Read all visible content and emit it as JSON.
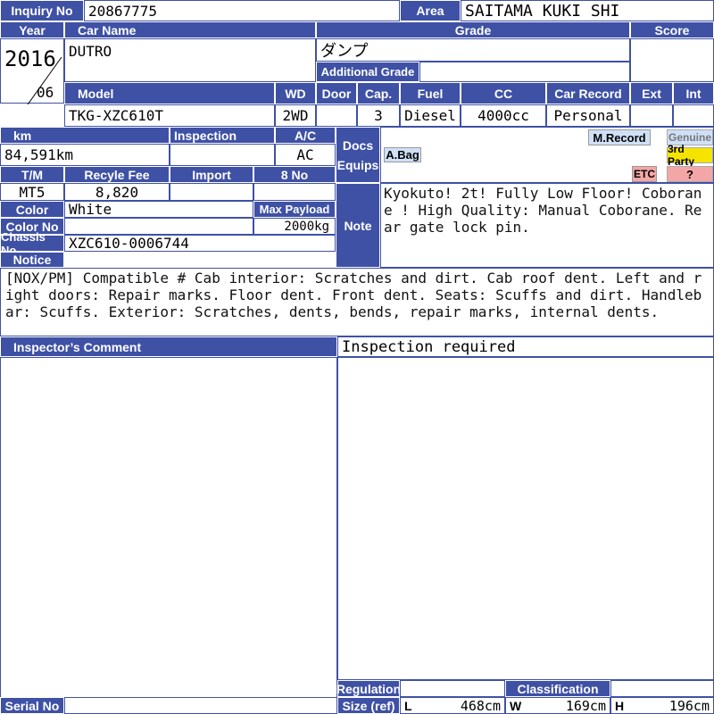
{
  "headers": {
    "inquiry_no": "Inquiry No",
    "area": "Area",
    "year": "Year",
    "car_name": "Car Name",
    "grade": "Grade",
    "score": "Score",
    "additional_grade": "Additional Grade",
    "model": "Model",
    "wd": "WD",
    "door": "Door",
    "cap": "Cap.",
    "fuel": "Fuel",
    "cc": "CC",
    "car_record": "Car Record",
    "ext": "Ext",
    "int": "Int",
    "km": "km",
    "inspection": "Inspection",
    "ac": "A/C",
    "docs": "Docs",
    "equips": "Equips",
    "tm": "T/M",
    "recycle_fee": "Recyle Fee",
    "import": "Import",
    "eight_no": "8 No",
    "color": "Color",
    "max_payload": "Max Payload",
    "color_no": "Color No",
    "note": "Note",
    "chassis_no": "Chassis No",
    "notice": "Notice",
    "inspectors_comment": "Inspector’s Comment",
    "regulation": "Regulation",
    "classification": "Classification",
    "size_ref": "Size (ref)",
    "serial_no": "Serial No"
  },
  "values": {
    "inquiry_no": "20867775",
    "area": "SAITAMA KUKI SHI",
    "year": "2016",
    "month": "06",
    "car_name": "DUTRO",
    "grade": "ダンプ",
    "additional_grade": "",
    "score": "",
    "model": "TKG-XZC610T",
    "wd": "2WD",
    "door": "",
    "cap": "3",
    "fuel": "Diesel",
    "cc": "4000cc",
    "car_record": "Personal",
    "ext": "",
    "int": "",
    "km": "84,591km",
    "inspection": "",
    "ac": "AC",
    "tm": "MT5",
    "recycle_fee": "8,820",
    "import": "",
    "eight_no": "",
    "color": "White",
    "max_payload": "2000kg",
    "color_no": "",
    "chassis_no": "XZC610-0006744",
    "note": "Kyokuto! 2t! Fully Low Floor! Coborane ! High Quality: Manual Coborane. Rear gate lock pin.",
    "notice": "[NOX/PM] Compatible # Cab interior: Scratches and dirt. Cab roof dent. Left and right doors: Repair marks. Floor dent. Front dent. Seats: Scuffs and dirt. Handlebar: Scuffs. Exterior: Scratches, dents, bends, repair marks, internal dents.",
    "inspection_status": "Inspection required",
    "size_l_label": "L",
    "size_l": "468cm",
    "size_w_label": "W",
    "size_w": "169cm",
    "size_h_label": "H",
    "size_h": "196cm",
    "serial_no": ""
  },
  "equip_tags": {
    "abag": "A.Bag",
    "m_record": "M.Record",
    "genuine": "Genuine",
    "third_party": "3rd Party",
    "etc": "ETC",
    "unknown": "?"
  },
  "colors": {
    "header": "#3f51a5",
    "tag_blue": "#cfe0f6",
    "tag_yellow": "#f5e400",
    "tag_pink": "#f4a6a6"
  }
}
